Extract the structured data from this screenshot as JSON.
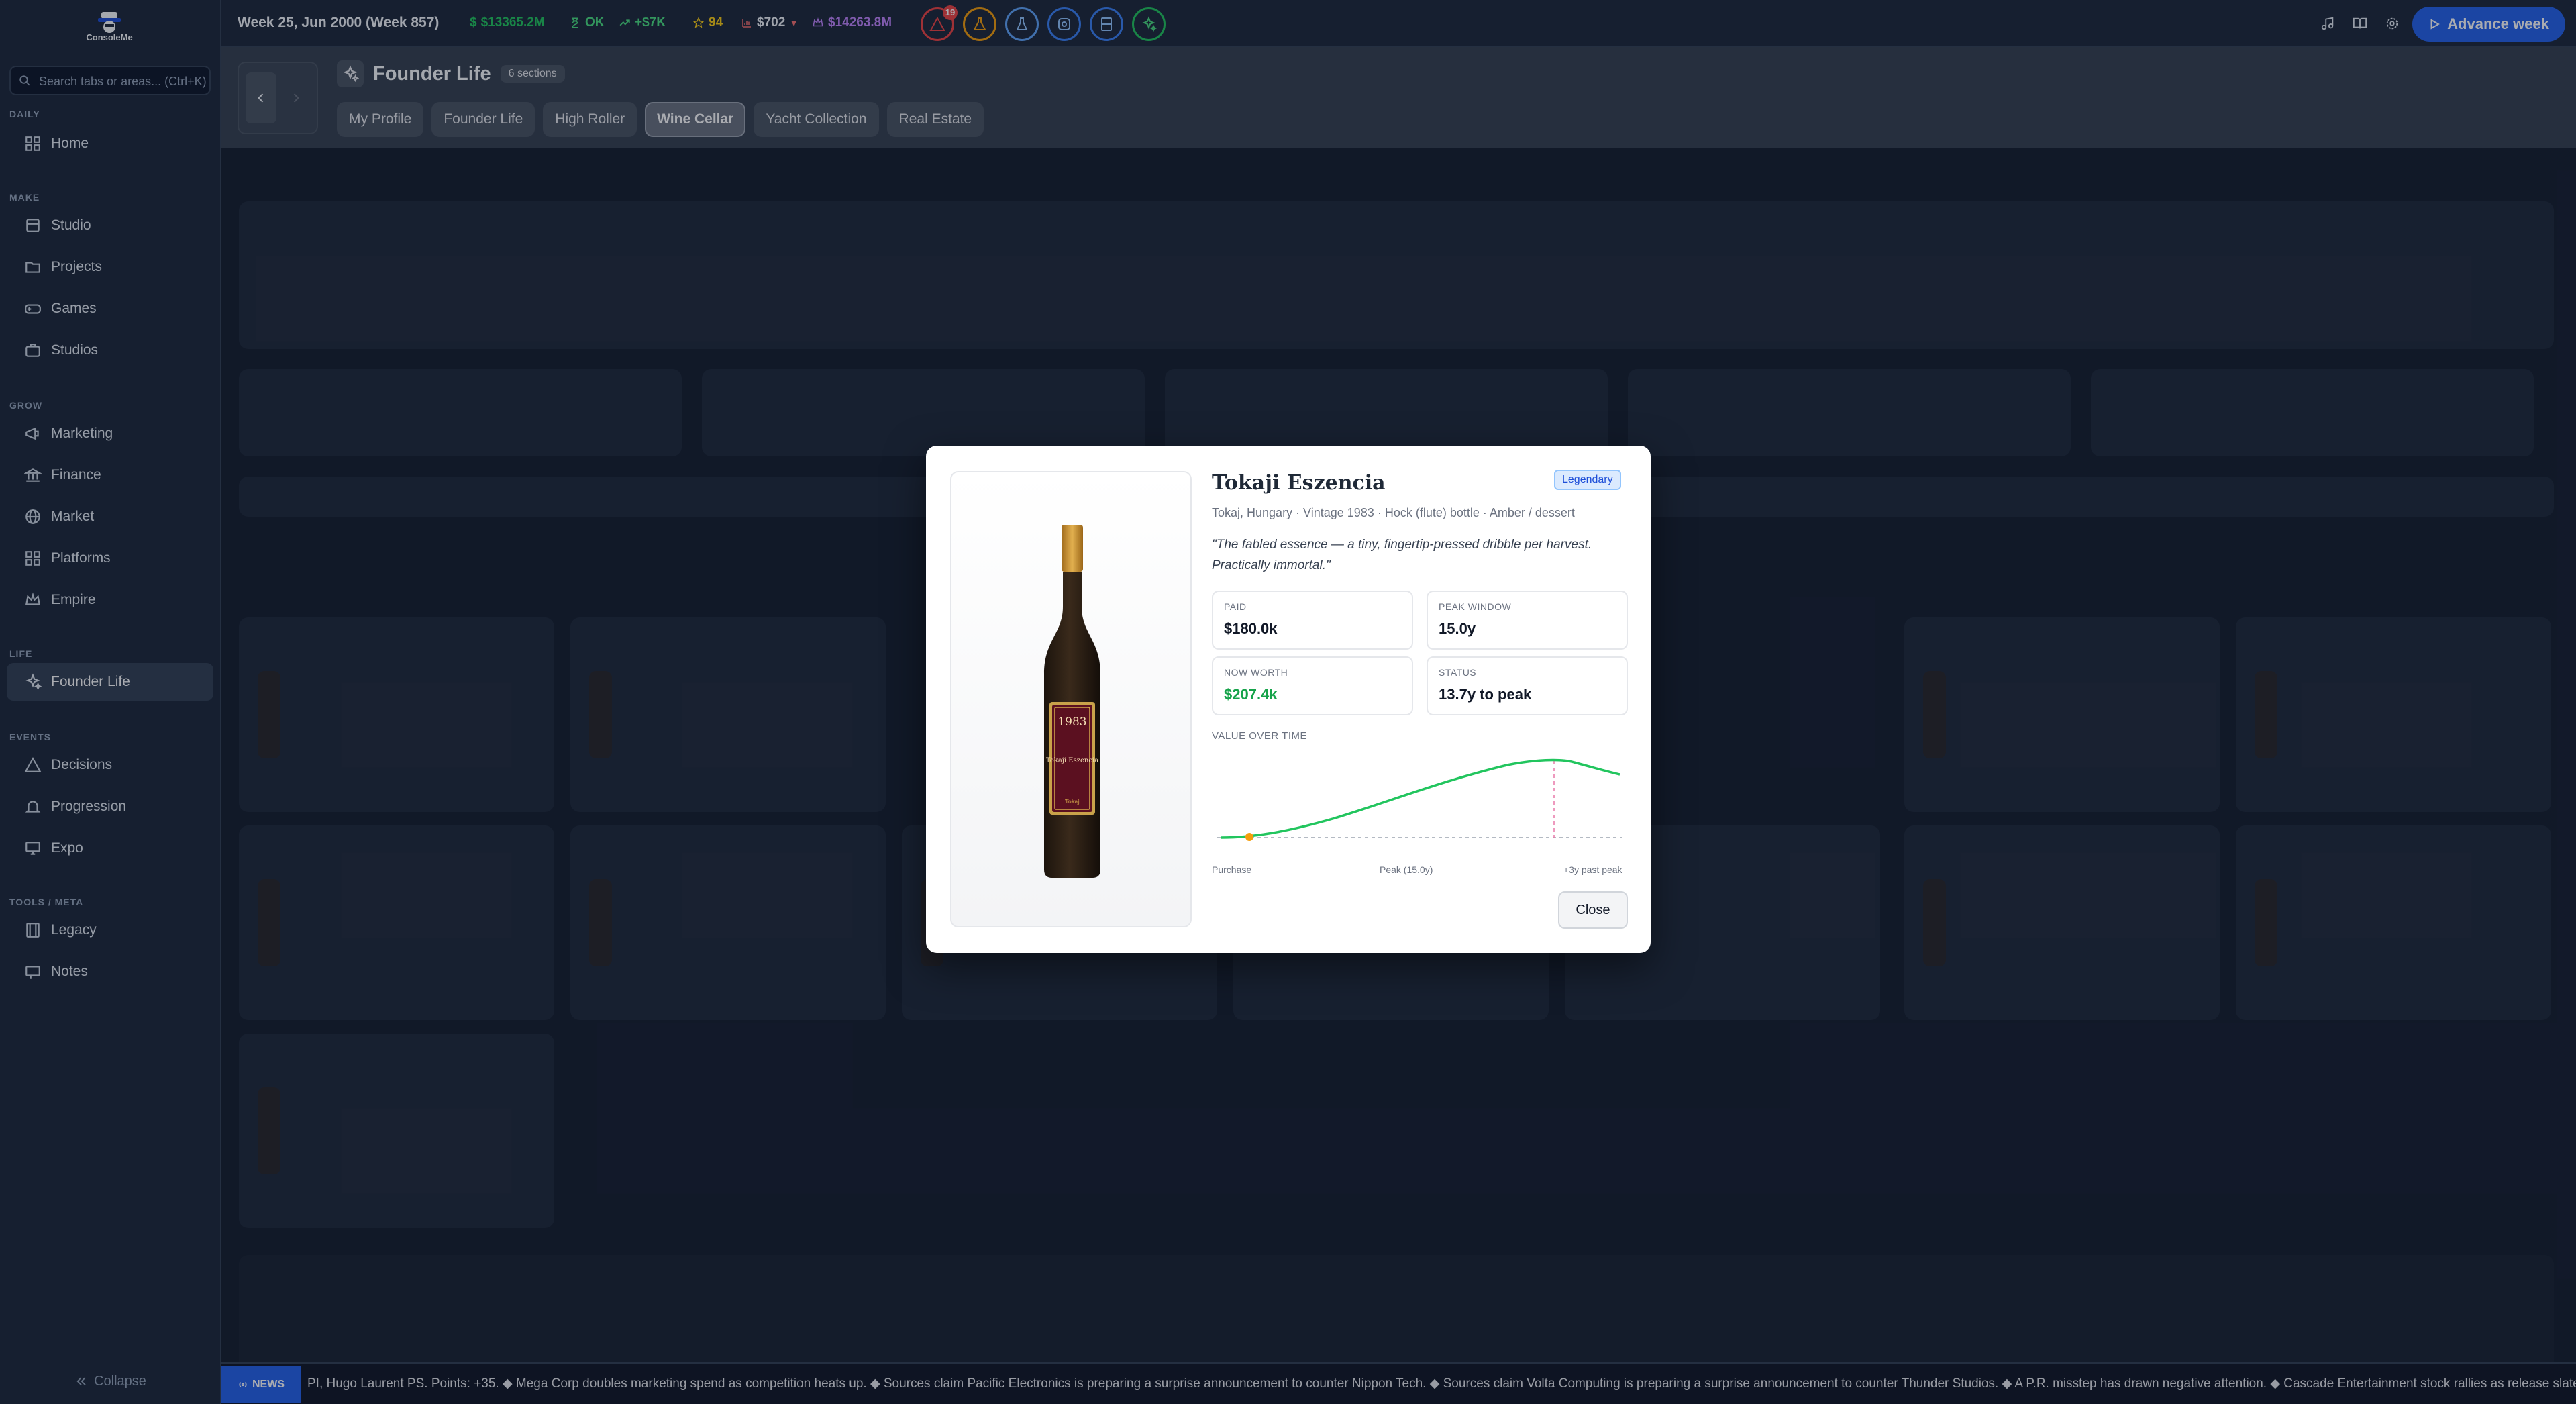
{
  "app": {
    "logo_text": "ConsoleMe"
  },
  "search": {
    "placeholder": "Search tabs or areas... (Ctrl+K)"
  },
  "sidebar": {
    "groups": [
      {
        "label": "DAILY",
        "items": [
          {
            "label": "Home",
            "icon": "grid-icon"
          }
        ]
      },
      {
        "label": "MAKE",
        "items": [
          {
            "label": "Studio",
            "icon": "building-icon"
          },
          {
            "label": "Projects",
            "icon": "folder-icon"
          },
          {
            "label": "Games",
            "icon": "gamepad-icon"
          },
          {
            "label": "Studios",
            "icon": "briefcase-icon"
          }
        ]
      },
      {
        "label": "GROW",
        "items": [
          {
            "label": "Marketing",
            "icon": "megaphone-icon"
          },
          {
            "label": "Finance",
            "icon": "bank-icon"
          },
          {
            "label": "Market",
            "icon": "globe-icon"
          },
          {
            "label": "Platforms",
            "icon": "grid-icon"
          },
          {
            "label": "Empire",
            "icon": "crown-icon"
          }
        ]
      },
      {
        "label": "LIFE",
        "items": [
          {
            "label": "Founder Life",
            "icon": "sparkles-icon",
            "active": true
          }
        ]
      },
      {
        "label": "EVENTS",
        "items": [
          {
            "label": "Decisions",
            "icon": "warning-icon"
          },
          {
            "label": "Progression",
            "icon": "bell-icon"
          },
          {
            "label": "Expo",
            "icon": "monitor-icon"
          }
        ]
      },
      {
        "label": "TOOLS / META",
        "items": [
          {
            "label": "Legacy",
            "icon": "film-icon"
          },
          {
            "label": "Notes",
            "icon": "notepad-icon"
          }
        ]
      }
    ],
    "collapse_label": "Collapse"
  },
  "topbar": {
    "week": "Week 25, Jun 2000 (Week 857)",
    "cash": "$13365.2M",
    "status": "OK",
    "trend": "+$7K",
    "rating": "94",
    "price": "$702",
    "net_worth": "$14263.8M",
    "alert_count": "19",
    "colors": {
      "cash": "#22c55e",
      "status": "#4ade80",
      "trend": "#4ade80",
      "rating": "#facc15",
      "price": "#f1f5f9",
      "net_worth": "#c084fc"
    },
    "advance_label": "Advance week"
  },
  "header": {
    "title": "Founder Life",
    "sections_badge": "6 sections",
    "tabs": [
      {
        "label": "My Profile"
      },
      {
        "label": "Founder Life"
      },
      {
        "label": "High Roller"
      },
      {
        "label": "Wine Cellar",
        "active": true
      },
      {
        "label": "Yacht Collection"
      },
      {
        "label": "Real Estate"
      }
    ]
  },
  "modal": {
    "name": "Tokaji Eszencia",
    "rarity": "Legendary",
    "subtitle": "Tokaj, Hungary · Vintage 1983 · Hock (flute) bottle · Amber / dessert",
    "quote": "\"The fabled essence — a tiny, fingertip-pressed dribble per harvest. Practically immortal.\"",
    "label_year": "1983",
    "label_name": "Tokaji Eszencia",
    "label_region": "Tokaj",
    "stats": {
      "paid_label": "PAID",
      "paid": "$180.0k",
      "peak_label": "PEAK WINDOW",
      "peak": "15.0y",
      "worth_label": "NOW WORTH",
      "worth": "$207.4k",
      "status_label": "STATUS",
      "status": "13.7y to peak"
    },
    "chart_title": "VALUE OVER TIME",
    "x_labels": {
      "start": "Purchase",
      "peak": "Peak (15.0y)",
      "end": "+3y past peak"
    },
    "close_label": "Close",
    "colors": {
      "line": "#22c55e",
      "marker": "#f59e0b",
      "rarity": "#1d4ed8"
    }
  },
  "news": {
    "badge": "NEWS",
    "text": "PI, Hugo Laurent PS. Points: +35. ◆ Mega Corp doubles marketing spend as competition heats up. ◆ Sources claim Pacific Electronics is preparing a surprise announcement to counter Nippon Tech. ◆ Sources claim Volta Computing is preparing a surprise announcement to counter Thunder Studios. ◆ A P.R. misstep has drawn negative attention. ◆ Cascade Entertainment stock rallies as release slate"
  }
}
